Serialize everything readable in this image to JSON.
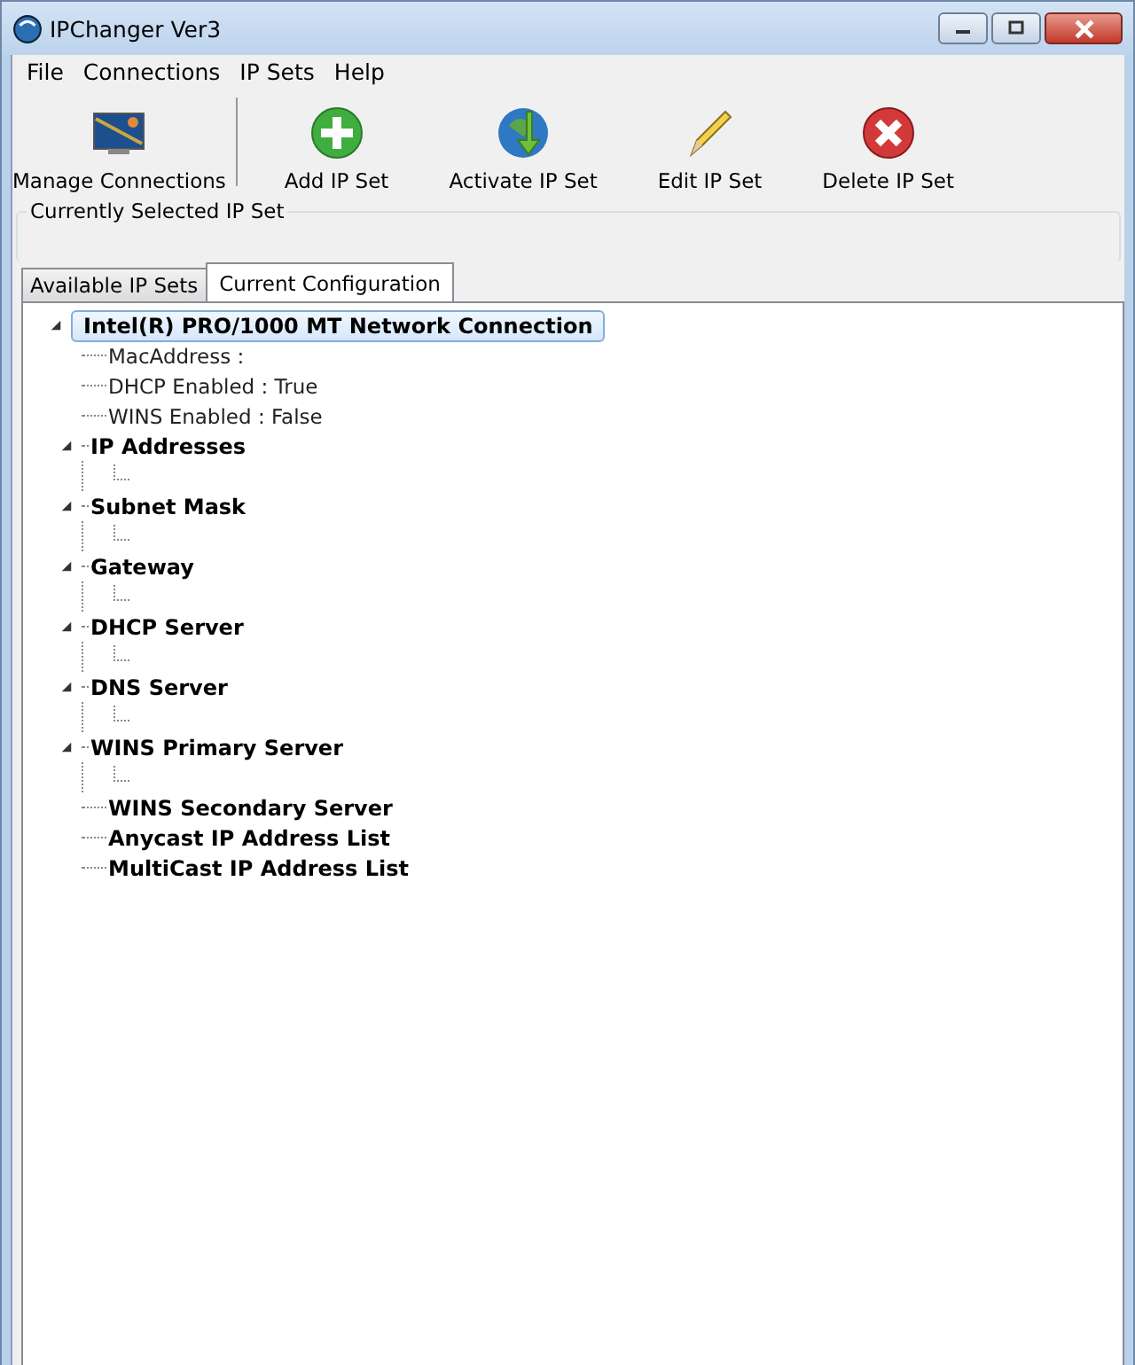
{
  "window": {
    "title": "IPChanger Ver3"
  },
  "menu": [
    "File",
    "Connections",
    "IP Sets",
    "Help"
  ],
  "toolbar": [
    {
      "kind": "monitor",
      "label": "Manage Connections"
    },
    {
      "kind": "add",
      "label": "Add IP Set"
    },
    {
      "kind": "activate",
      "label": "Activate IP Set"
    },
    {
      "kind": "edit",
      "label": "Edit IP Set"
    },
    {
      "kind": "delete",
      "label": "Delete IP Set"
    }
  ],
  "selected_set": {
    "title": "Currently Selected IP Set"
  },
  "tabs": [
    {
      "label": "Available IP Sets",
      "selected": false
    },
    {
      "label": "Current Configuration",
      "selected": true
    }
  ],
  "tree": {
    "label": "Intel(R) PRO/1000 MT Network Connection",
    "selected": true,
    "expanded": true,
    "children": [
      {
        "kind": "property",
        "label": "MacAddress  :"
      },
      {
        "kind": "property",
        "label": "DHCP Enabled : True"
      },
      {
        "kind": "property",
        "label": "WINS Enabled : False"
      },
      {
        "kind": "group",
        "label": "IP Addresses",
        "expanded": true
      },
      {
        "kind": "group",
        "label": "Subnet Mask",
        "expanded": true
      },
      {
        "kind": "group",
        "label": "Gateway",
        "expanded": true
      },
      {
        "kind": "group",
        "label": "DHCP Server",
        "expanded": true
      },
      {
        "kind": "group",
        "label": "DNS Server",
        "expanded": true
      },
      {
        "kind": "group",
        "label": "WINS Primary Server",
        "expanded": true
      },
      {
        "kind": "group",
        "label": "WINS Secondary Server",
        "expanded": false
      },
      {
        "kind": "group",
        "label": "Anycast IP Address List",
        "expanded": false
      },
      {
        "kind": "group",
        "label": "MultiCast IP Address List",
        "expanded": false
      }
    ]
  }
}
